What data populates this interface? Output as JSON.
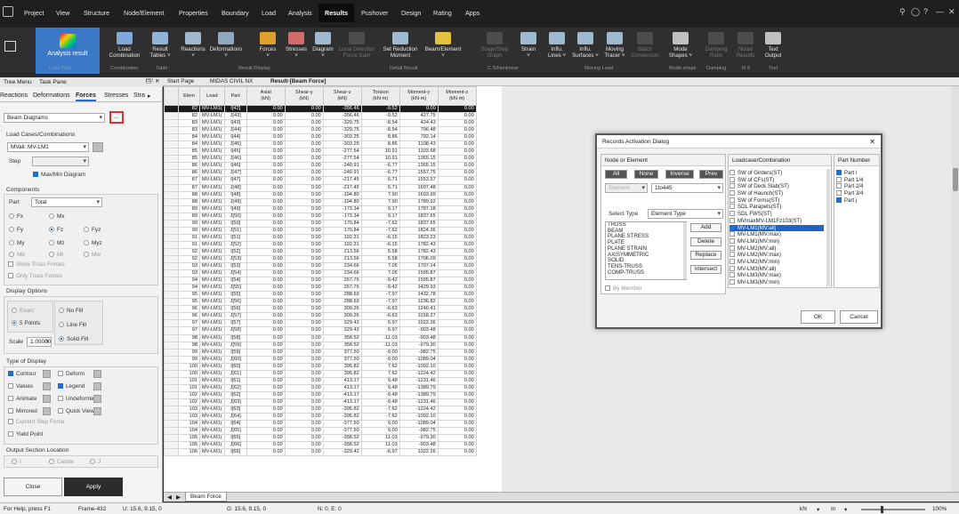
{
  "menu": {
    "items": [
      "Project",
      "View",
      "Structure",
      "Node/Element",
      "Properties",
      "Boundary",
      "Load",
      "Analysis",
      "Results",
      "Pushover",
      "Design",
      "Rating",
      "Apps"
    ],
    "active": "Results"
  },
  "ribbon": {
    "primary": "Analysis result",
    "buttons": [
      {
        "l1": "Load",
        "l2": "Combination",
        "color": "#7fa9d8"
      },
      {
        "l1": "Result",
        "l2": "Tables ˅",
        "color": "#8fb3d9"
      },
      {
        "l1": "Reactions",
        "l2": "˅",
        "color": "#9fb7cf"
      },
      {
        "l1": "Deformations",
        "l2": "˅",
        "color": "#8fa7bf"
      },
      {
        "l1": "Forces",
        "l2": "˅",
        "color": "#e0a030"
      },
      {
        "l1": "Stresses",
        "l2": "˅",
        "color": "#d46a6a"
      },
      {
        "l1": "Diagram",
        "l2": "˅",
        "color": "#a0b8d0"
      },
      {
        "l1": "Local Direction",
        "l2": "Force Sum",
        "color": "#888",
        "disabled": true
      },
      {
        "l1": "Set Reduction",
        "l2": "Moment",
        "color": "#a0b8d0"
      },
      {
        "l1": "Beam/Element",
        "l2": "˅",
        "color": "#e6c040"
      },
      {
        "l1": "Stage/Step",
        "l2": "Graph",
        "color": "#888",
        "disabled": true
      },
      {
        "l1": "Strain",
        "l2": "˅",
        "color": "#9fb7cf"
      },
      {
        "l1": "Influ.",
        "l2": "Lines ˅",
        "color": "#9fb7cf"
      },
      {
        "l1": "Influ.",
        "l2": "Surfaces ˅",
        "color": "#9fb7cf"
      },
      {
        "l1": "Moving",
        "l2": "Tracer ˅",
        "color": "#9fb7cf"
      },
      {
        "l1": "Batch",
        "l2": "Conversion",
        "color": "#888",
        "disabled": true
      },
      {
        "l1": "Mode",
        "l2": "Shapes ˅",
        "color": "#c0c0c0"
      },
      {
        "l1": "Damping",
        "l2": "Ratio",
        "color": "#888",
        "disabled": true
      },
      {
        "l1": "Nodal",
        "l2": "Results",
        "color": "#888",
        "disabled": true
      },
      {
        "l1": "Text",
        "l2": "Output",
        "color": "#c0c0c0"
      }
    ],
    "groups": [
      "Load Type",
      "Combination",
      "Table",
      "Result Display",
      "Detail Result",
      "C.S/Nonlinear",
      "Moving Load",
      "Mode shape",
      "Damping",
      "R.S",
      "Text"
    ]
  },
  "panel": {
    "tabs": [
      "Tree Menu",
      "Task Pane"
    ],
    "subtabs": [
      "Reactions",
      "Deformations",
      "Forces",
      "Stresses",
      "Stra"
    ],
    "active_subtab": "Forces",
    "diagram_type": "Beam Diagrams",
    "dots": "...",
    "load_cases_label": "Load Cases/Combinations",
    "load_case": "MVall: MV-LM1",
    "step_label": "Step",
    "max_min": "Max/Min Diagram",
    "components_label": "Components",
    "part_label": "Part",
    "part_value": "Total",
    "components": [
      [
        "Fx",
        "Mx",
        ""
      ],
      [
        "Fy",
        "Fz",
        "Fyz"
      ],
      [
        "My",
        "Mz",
        "Myz"
      ],
      [
        "Mb",
        "Mt",
        "Mw"
      ]
    ],
    "show_truss": "Show Truss Forces",
    "only_truss": "Only Truss Forces",
    "display_options_label": "Display Options",
    "exact": "Exact",
    "points": "5 Points",
    "no_fill": "No Fill",
    "line_fill": "Line Fill",
    "solid_fill": "Solid Fill",
    "scale_label": "Scale",
    "scale_value": "1.00000",
    "type_display_label": "Type of Display",
    "types": [
      [
        "Contour",
        "Deform"
      ],
      [
        "Values",
        "Legend"
      ],
      [
        "Animate",
        "Undeformed"
      ],
      [
        "Mirrored",
        "Quick View"
      ]
    ],
    "current_step": "Current Step Force",
    "yield_point": "Yield Point",
    "output_section_label": "Output Section Location",
    "sections": [
      "I",
      "Center",
      "J"
    ],
    "close": "Close",
    "apply": "Apply"
  },
  "doc_tabs": [
    "Start Page",
    "MIDAS CIVIL NX",
    "Result-[Beam Force]"
  ],
  "table": {
    "headers": [
      "Elem",
      "Load",
      "Part",
      "Axial\n(kN)",
      "Shear-y\n(kN)",
      "Shear-z\n(kN)",
      "Torsion\n(kN·m)",
      "Moment-y\n(kN·m)",
      "Moment-z\n(kN·m)"
    ],
    "rows": [
      [
        "82",
        "MV-LM1(",
        "I[42]",
        "0.00",
        "0.00",
        "-356.46",
        "-9.52",
        "0.00",
        "0.00"
      ],
      [
        "82",
        "MV-LM1(",
        "J[43]",
        "0.00",
        "0.00",
        "-356.46",
        "-9.52",
        "427.75",
        "0.00"
      ],
      [
        "83",
        "MV-LM1(",
        "I[43]",
        "0.00",
        "0.00",
        "-329.75",
        "-8.54",
        "424.43",
        "0.00"
      ],
      [
        "83",
        "MV-LM1(",
        "J[44]",
        "0.00",
        "0.00",
        "-329.75",
        "-8.54",
        "796.48",
        "0.00"
      ],
      [
        "84",
        "MV-LM1(",
        "I[44]",
        "0.00",
        "0.00",
        "-303.25",
        "8.86",
        "792.14",
        "0.00"
      ],
      [
        "84",
        "MV-LM1(",
        "J[45]",
        "0.00",
        "0.00",
        "-303.25",
        "8.86",
        "1108.43",
        "0.00"
      ],
      [
        "85",
        "MV-LM1(",
        "I[45]",
        "0.00",
        "0.00",
        "-277.54",
        "10.91",
        "1103.68",
        "0.00"
      ],
      [
        "85",
        "MV-LM1(",
        "J[46]",
        "0.00",
        "0.00",
        "-277.54",
        "10.91",
        "1365.15",
        "0.00"
      ],
      [
        "86",
        "MV-LM1(",
        "I[46]",
        "0.00",
        "0.00",
        "-240.91",
        "-6.77",
        "1365.15",
        "0.00"
      ],
      [
        "86",
        "MV-LM1(",
        "J[47]",
        "0.00",
        "0.00",
        "-240.91",
        "-6.77",
        "1557.75",
        "0.00"
      ],
      [
        "87",
        "MV-LM1(",
        "I[47]",
        "0.00",
        "0.00",
        "-217.45",
        "6.71",
        "1553.57",
        "0.00"
      ],
      [
        "87",
        "MV-LM1(",
        "J[48]",
        "0.00",
        "0.00",
        "-217.45",
        "6.71",
        "1697.48",
        "0.00"
      ],
      [
        "88",
        "MV-LM1(",
        "I[48]",
        "0.00",
        "0.00",
        "-194.80",
        "7.90",
        "1693.99",
        "0.00"
      ],
      [
        "88",
        "MV-LM1(",
        "J[49]",
        "0.00",
        "0.00",
        "-194.80",
        "7.90",
        "1789.92",
        "0.00"
      ],
      [
        "89",
        "MV-LM1(",
        "I[49]",
        "0.00",
        "0.00",
        "-173.34",
        "9.17",
        "1787.18",
        "0.00"
      ],
      [
        "89",
        "MV-LM1(",
        "J[50]",
        "0.00",
        "0.00",
        "-173.34",
        "9.17",
        "1837.65",
        "0.00"
      ],
      [
        "90",
        "MV-LM1(",
        "I[50]",
        "0.00",
        "0.00",
        "170.84",
        "-7.62",
        "1837.65",
        "0.00"
      ],
      [
        "90",
        "MV-LM1(",
        "J[51]",
        "0.00",
        "0.00",
        "170.84",
        "-7.62",
        "1824.36",
        "0.00"
      ],
      [
        "91",
        "MV-LM1(",
        "I[51]",
        "0.00",
        "0.00",
        "192.31",
        "-6.15",
        "1823.23",
        "0.00"
      ],
      [
        "91",
        "MV-LM1(",
        "J[52]",
        "0.00",
        "0.00",
        "192.31",
        "-6.15",
        "1782.43",
        "0.00"
      ],
      [
        "92",
        "MV-LM1(",
        "I[52]",
        "0.00",
        "0.00",
        "213.56",
        "5.58",
        "1782.43",
        "0.00"
      ],
      [
        "92",
        "MV-LM1(",
        "J[53]",
        "0.00",
        "0.00",
        "213.56",
        "5.58",
        "1706.09",
        "0.00"
      ],
      [
        "93",
        "MV-LM1(",
        "I[53]",
        "0.00",
        "0.00",
        "234.66",
        "7.05",
        "1707.14",
        "0.00"
      ],
      [
        "93",
        "MV-LM1(",
        "J[54]",
        "0.00",
        "0.00",
        "234.66",
        "7.05",
        "1595.87",
        "0.00"
      ],
      [
        "94",
        "MV-LM1(",
        "I[54]",
        "0.00",
        "0.00",
        "267.76",
        "-9.42",
        "1595.87",
        "0.00"
      ],
      [
        "94",
        "MV-LM1(",
        "J[55]",
        "0.00",
        "0.00",
        "267.76",
        "-9.42",
        "1429.93",
        "0.00"
      ],
      [
        "95",
        "MV-LM1(",
        "I[55]",
        "0.00",
        "0.00",
        "288.69",
        "-7.97",
        "1432.78",
        "0.00"
      ],
      [
        "95",
        "MV-LM1(",
        "J[56]",
        "0.00",
        "0.00",
        "288.69",
        "-7.97",
        "1236.82",
        "0.00"
      ],
      [
        "96",
        "MV-LM1(",
        "I[56]",
        "0.00",
        "0.00",
        "309.26",
        "-6.63",
        "1240.41",
        "0.00"
      ],
      [
        "96",
        "MV-LM1(",
        "J[57]",
        "0.00",
        "0.00",
        "309.26",
        "-6.63",
        "1018.27",
        "0.00"
      ],
      [
        "97",
        "MV-LM1(",
        "I[57]",
        "0.00",
        "0.00",
        "329.42",
        "6.97",
        "1022.26",
        "0.00"
      ],
      [
        "97",
        "MV-LM1(",
        "J[58]",
        "0.00",
        "0.00",
        "329.42",
        "6.97",
        "-903.48",
        "0.00"
      ],
      [
        "98",
        "MV-LM1(",
        "I[58]",
        "0.00",
        "0.00",
        "358.52",
        "-11.03",
        "-903.48",
        "0.00"
      ],
      [
        "98",
        "MV-LM1(",
        "J[59]",
        "0.00",
        "0.00",
        "358.52",
        "-11.03",
        "-979.30",
        "0.00"
      ],
      [
        "99",
        "MV-LM1(",
        "I[59]",
        "0.00",
        "0.00",
        "377.50",
        "-9.00",
        "-982.75",
        "0.00"
      ],
      [
        "99",
        "MV-LM1(",
        "J[60]",
        "0.00",
        "0.00",
        "377.50",
        "-9.00",
        "-1089.04",
        "0.00"
      ],
      [
        "100",
        "MV-LM1(",
        "I[60]",
        "0.00",
        "0.00",
        "395.82",
        "7.62",
        "-1092.10",
        "0.00"
      ],
      [
        "100",
        "MV-LM1(",
        "J[61]",
        "0.00",
        "0.00",
        "395.82",
        "7.62",
        "-1224.42",
        "0.00"
      ],
      [
        "101",
        "MV-LM1(",
        "I[61]",
        "0.00",
        "0.00",
        "413.17",
        "9.48",
        "-1231.46",
        "0.00"
      ],
      [
        "101",
        "MV-LM1(",
        "J[62]",
        "0.00",
        "0.00",
        "413.17",
        "9.48",
        "-1389.79",
        "0.00"
      ],
      [
        "102",
        "MV-LM1(",
        "I[62]",
        "0.00",
        "0.00",
        "-413.17",
        "-9.48",
        "-1389.79",
        "0.00"
      ],
      [
        "102",
        "MV-LM1(",
        "J[63]",
        "0.00",
        "0.00",
        "-413.17",
        "-9.48",
        "-1231.46",
        "0.00"
      ],
      [
        "103",
        "MV-LM1(",
        "I[63]",
        "0.00",
        "0.00",
        "-395.82",
        "-7.62",
        "-1224.42",
        "0.00"
      ],
      [
        "103",
        "MV-LM1(",
        "J[64]",
        "0.00",
        "0.00",
        "-395.82",
        "-7.62",
        "-1092.10",
        "0.00"
      ],
      [
        "104",
        "MV-LM1(",
        "I[64]",
        "0.00",
        "0.00",
        "-377.50",
        "9.00",
        "-1089.04",
        "0.00"
      ],
      [
        "104",
        "MV-LM1(",
        "J[65]",
        "0.00",
        "0.00",
        "-377.50",
        "9.00",
        "-982.75",
        "0.00"
      ],
      [
        "105",
        "MV-LM1(",
        "I[65]",
        "0.00",
        "0.00",
        "-358.52",
        "11.03",
        "-979.30",
        "0.00"
      ],
      [
        "105",
        "MV-LM1(",
        "J[66]",
        "0.00",
        "0.00",
        "-358.52",
        "11.03",
        "-903.48",
        "0.00"
      ],
      [
        "106",
        "MV-LM1(",
        "I[66]",
        "0.00",
        "0.00",
        "-329.42",
        "-6.97",
        "1022.26",
        "0.00"
      ]
    ]
  },
  "sheet_tab": "Beam Force",
  "status": {
    "help": "For Help, press F1",
    "frame": "Frame-432",
    "u": "U: 15.6, 9.15, 0",
    "g": "G: 15.6, 9.15, 0",
    "n": "N: 0, E: 0",
    "unit1": "kN",
    "unit2": "m",
    "zoom": "100%"
  },
  "dialog": {
    "title": "Records Activation Dialog",
    "node_header": "Node or Element",
    "buttons": [
      "All",
      "None",
      "Inverse",
      "Prev"
    ],
    "element_dropdown": "Element",
    "range": "1to445",
    "select_type_label": "Select Type",
    "select_type_value": "Element Type",
    "types": [
      "TRUSS",
      "BEAM",
      "PLANE STRESS",
      "PLATE",
      "PLANE STRAIN",
      "AXISYMMETRIC",
      "SOLID",
      "TENS-TRUSS",
      "COMP-TRUSS"
    ],
    "actions": [
      "Add",
      "Delete",
      "Replace",
      "Intersect"
    ],
    "by_member": "By Member",
    "lc_header": "Loadcase/Combination",
    "load_cases": [
      {
        "name": "SW of Girders(ST)",
        "checked": false
      },
      {
        "name": "SW of CFs(ST)",
        "checked": false
      },
      {
        "name": "SW of Deck Slab(ST)",
        "checked": false
      },
      {
        "name": "SW of Haunch(ST)",
        "checked": false
      },
      {
        "name": "SW of Forms(ST)",
        "checked": false
      },
      {
        "name": "SDL Parapets(ST)",
        "checked": false
      },
      {
        "name": "SDL FWS(ST)",
        "checked": false
      },
      {
        "name": "MVmaxMV-LM1Fz103(ST)",
        "checked": false
      },
      {
        "name": "MV-LM1(MV:all)",
        "checked": true,
        "selected": true
      },
      {
        "name": "MV-LM1(MV:max)",
        "checked": false
      },
      {
        "name": "MV-LM1(MV:min)",
        "checked": false
      },
      {
        "name": "MV-LM2(MV:all)",
        "checked": false
      },
      {
        "name": "MV-LM2(MV:max)",
        "checked": false
      },
      {
        "name": "MV-LM2(MV:min)",
        "checked": false
      },
      {
        "name": "MV-LM3(MV:all)",
        "checked": false
      },
      {
        "name": "MV-LM3(MV:max)",
        "checked": false
      },
      {
        "name": "MV-LM3(MV:min)",
        "checked": false
      }
    ],
    "part_header": "Part Number",
    "parts": [
      {
        "name": "Part  i",
        "checked": true
      },
      {
        "name": "Part 1/4",
        "checked": false
      },
      {
        "name": "Part 2/4",
        "checked": false
      },
      {
        "name": "Part 3/4",
        "checked": false
      },
      {
        "name": "Part  j",
        "checked": true
      }
    ],
    "ok": "OK",
    "cancel": "Cancel"
  }
}
